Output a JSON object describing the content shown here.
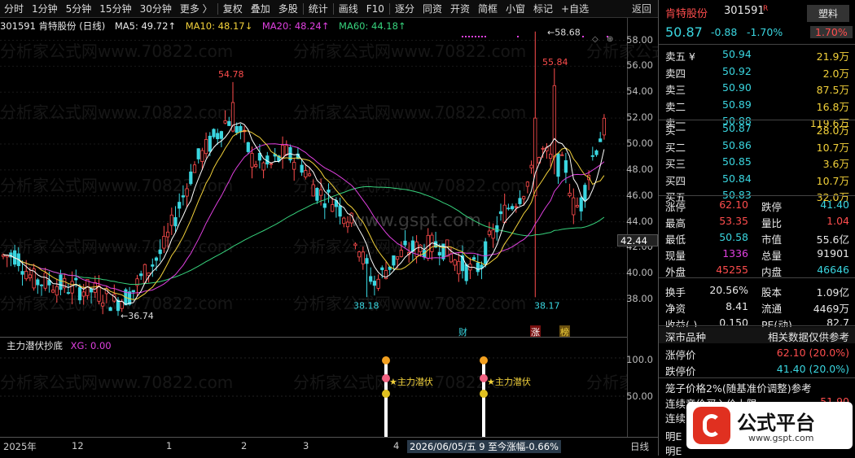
{
  "toolbar": {
    "items": [
      "分时",
      "1分钟",
      "5分钟",
      "15分钟",
      "30分钟",
      "更多 〉",
      "复权",
      "叠加",
      "多股",
      "统计",
      "画线",
      "F10",
      "逐分",
      "同资",
      "开资",
      "简框",
      "小窗",
      "标记",
      "+自选",
      "返回"
    ]
  },
  "info": {
    "code_name": "301591 肯特股份 (日线)",
    "ma5": "MA5: 49.72↑",
    "ma10": "MA10: 48.17↓",
    "ma20": "MA20: 48.24↑",
    "ma60": "MA60: 44.18↑"
  },
  "chart_labels": {
    "high1": "54.78",
    "high2": "55.84",
    "peak": "58.68",
    "low1": "36.74",
    "low2": "38.18",
    "low3": "38.17",
    "cai": "财",
    "zhang": "涨",
    "bang": "榜",
    "watermark": "www.gspt.com",
    "watermark2": "分析家公式网www.70822.com"
  },
  "colors": {
    "up": "#ff4d4d",
    "down": "#3ad6e0",
    "ma5": "#ffffff",
    "ma10": "#f2d13a",
    "ma20": "#e040e0",
    "ma60": "#37d37d"
  },
  "chart_data": [
    {
      "type": "candlestick",
      "title": "301591 肯特股份 (日线)",
      "ylim": [
        36,
        59
      ],
      "yticks": [
        38,
        40,
        42,
        44,
        46,
        48,
        50,
        52,
        54,
        56,
        58
      ],
      "series": [
        {
          "name": "MA5",
          "value": 49.72
        },
        {
          "name": "MA10",
          "value": 48.17
        },
        {
          "name": "MA20",
          "value": 48.24
        },
        {
          "name": "MA60",
          "value": 44.18
        }
      ],
      "annotations": [
        {
          "label": "54.78"
        },
        {
          "label": "55.84"
        },
        {
          "label": "58.68"
        },
        {
          "label": "36.74"
        },
        {
          "label": "38.18"
        },
        {
          "label": "38.17"
        }
      ]
    },
    {
      "type": "bar",
      "title": "主力潜伏抄底",
      "series": [
        {
          "name": "XG",
          "value": 0.0
        }
      ],
      "yticks": [
        50,
        100
      ],
      "annotations": [
        {
          "label": "★主力潜伏"
        },
        {
          "label": "★主力潜伏"
        }
      ]
    }
  ],
  "yaxis": {
    "ticks": [
      "58.00",
      "56.00",
      "54.00",
      "52.00",
      "50.00",
      "48.00",
      "46.00",
      "44.00",
      "42.00",
      "40.00",
      "38.00"
    ],
    "current": "42.44",
    "sub_ticks": [
      "100.0",
      "50.00"
    ]
  },
  "sub": {
    "title": "主力潜伏抄底",
    "xg": "XG: 0.00",
    "signal": "★主力潜伏"
  },
  "xaxis": {
    "labels": [
      "2025年",
      "12",
      "1",
      "2",
      "3",
      "4"
    ],
    "cursor": "2026/06/05/五 9 至今涨幅-0.66%",
    "period": "日线"
  },
  "panel": {
    "name": "肯特股份",
    "code": "301591",
    "flag": "R",
    "sector": "塑料",
    "price": "50.87",
    "change": "-0.88",
    "pct": "-1.70%",
    "sector_pct": "1.70%",
    "asks": [
      {
        "l": "卖五 ¥",
        "p": "50.94",
        "v": "21.9万"
      },
      {
        "l": "卖四",
        "p": "50.92",
        "v": "2.0万"
      },
      {
        "l": "卖三",
        "p": "50.90",
        "v": "87.5万"
      },
      {
        "l": "卖二",
        "p": "50.89",
        "v": "16.8万"
      },
      {
        "l": "卖一",
        "p": "50.88",
        "v": "119.6万"
      }
    ],
    "bids": [
      {
        "l": "买一",
        "p": "50.87",
        "v": "28.0万"
      },
      {
        "l": "买二",
        "p": "50.86",
        "v": "10.7万"
      },
      {
        "l": "买三",
        "p": "50.85",
        "v": "3.6万"
      },
      {
        "l": "买四",
        "p": "50.84",
        "v": "10.7万"
      },
      {
        "l": "买五",
        "p": "50.83",
        "v": "32.0万"
      }
    ],
    "stats": [
      [
        "涨停",
        "62.10",
        "跌停",
        "41.40"
      ],
      [
        "最高",
        "53.35",
        "量比",
        "1.04"
      ],
      [
        "最低",
        "50.58",
        "市值",
        "55.6亿"
      ],
      [
        "现量",
        "1336",
        "总量",
        "91901"
      ],
      [
        "外盘",
        "45255",
        "内盘",
        "46646"
      ],
      [
        "换手",
        "20.56%",
        "股本",
        "1.09亿"
      ],
      [
        "净资",
        "8.41",
        "流通",
        "4469万"
      ],
      [
        "收益(-)",
        "0.150",
        "PE(动)",
        "82.7"
      ]
    ],
    "market": "深市品种",
    "market_note": "相关数据仅供参考",
    "limit_up_label": "涨停价",
    "limit_up": "62.10 (20.0%)",
    "limit_dn_label": "跌停价",
    "limit_dn": "41.40 (20.0%)",
    "cage": "笼子价格2%(随基准价调整)参考",
    "cage_buy": "连续竞价买入价上限",
    "cage_buy_v": "51.90",
    "cage_sell": "连续",
    "logo": "公式平台",
    "logo_url": "www.gspt.com",
    "ming1": "明E",
    "ming2": "明E"
  }
}
